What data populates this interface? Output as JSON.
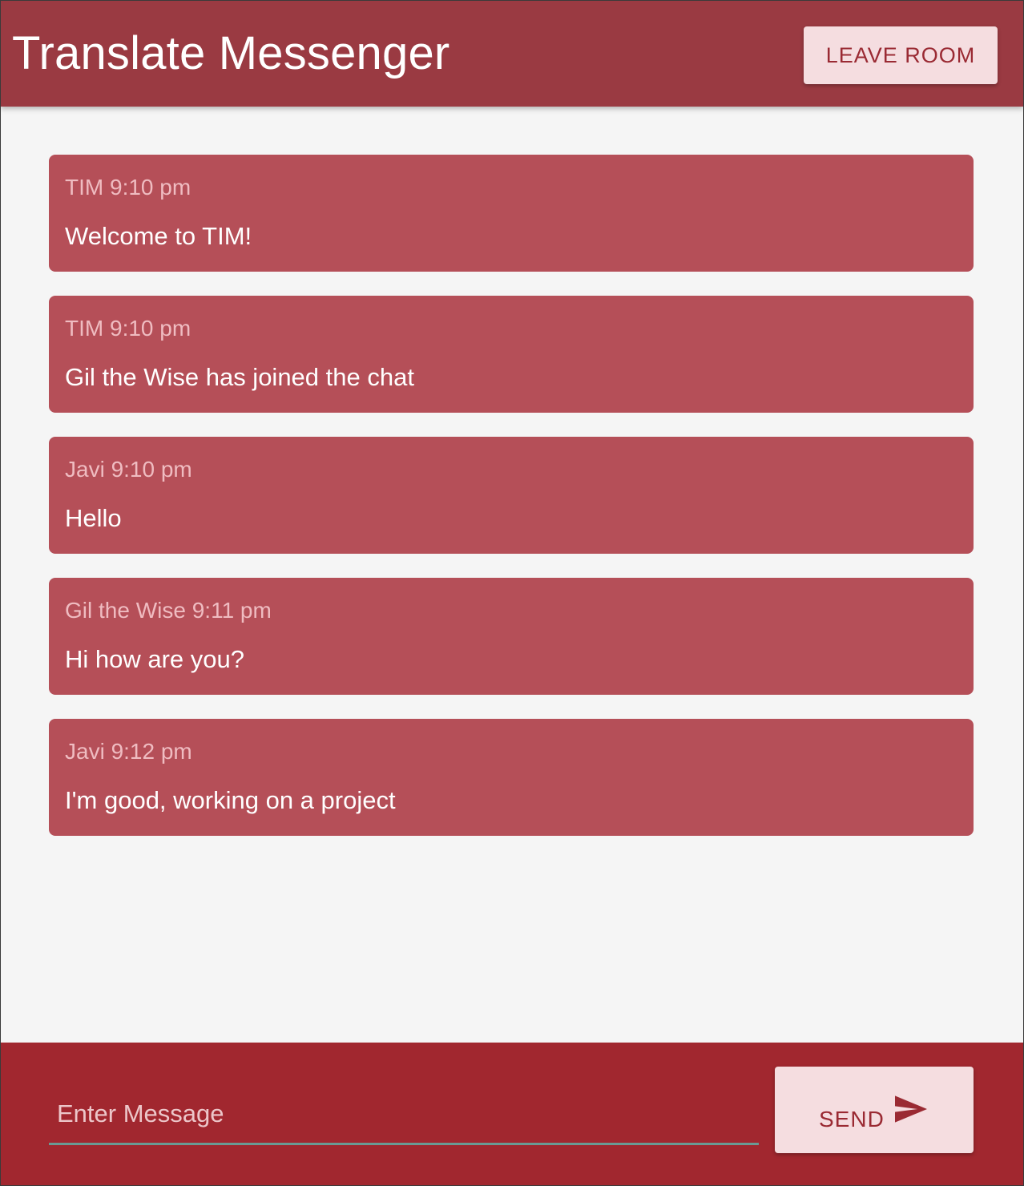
{
  "header": {
    "title": "Translate Messenger",
    "leave_label": "LEAVE ROOM"
  },
  "messages": [
    {
      "sender": "TIM",
      "time": "9:10 pm",
      "text": "Welcome to TIM!"
    },
    {
      "sender": "TIM",
      "time": "9:10 pm",
      "text": "Gil the Wise has joined the chat"
    },
    {
      "sender": "Javi",
      "time": "9:10 pm",
      "text": "Hello"
    },
    {
      "sender": "Gil the Wise",
      "time": "9:11 pm",
      "text": "Hi how are you?"
    },
    {
      "sender": "Javi",
      "time": "9:12 pm",
      "text": "I'm good, working on a project"
    }
  ],
  "composer": {
    "value": "",
    "placeholder": "Enter Message",
    "send_label": "SEND",
    "send_icon": "send-icon"
  },
  "colors": {
    "header": "#9a3a42",
    "message_card": "#b54f58",
    "footer": "#a1272f",
    "button_bg": "#f5dde0",
    "button_text": "#9a2a33",
    "input_underline": "#6a9a94"
  }
}
